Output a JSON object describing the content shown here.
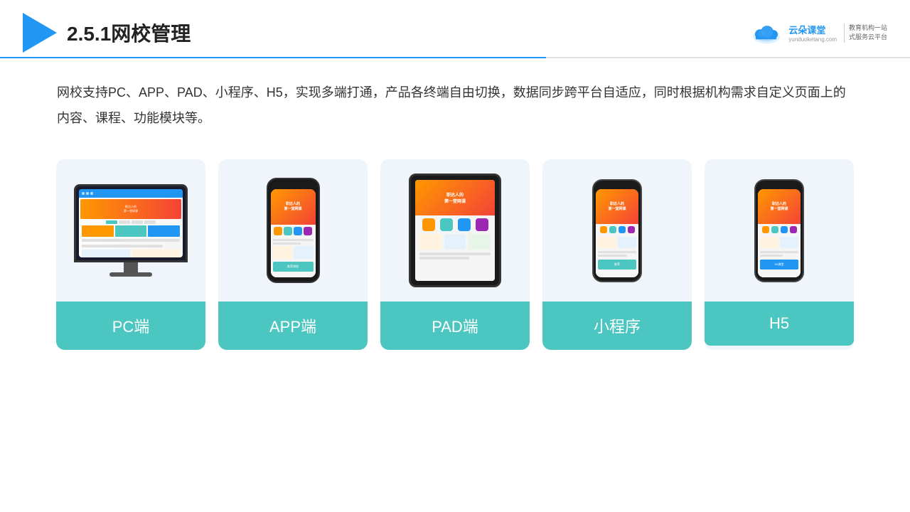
{
  "header": {
    "title": "2.5.1网校管理",
    "brand_cn": "云朵课堂",
    "brand_en": "yunduoketang.com",
    "brand_slogan_line1": "教育机构一站",
    "brand_slogan_line2": "式服务云平台"
  },
  "description": {
    "text": "网校支持PC、APP、PAD、小程序、H5，实现多端打通，产品各终端自由切换，数据同步跨平台自适应，同时根据机构需求自定义页面上的内容、课程、功能模块等。"
  },
  "cards": [
    {
      "id": "pc",
      "label": "PC端"
    },
    {
      "id": "app",
      "label": "APP端"
    },
    {
      "id": "pad",
      "label": "PAD端"
    },
    {
      "id": "miniprogram",
      "label": "小程序"
    },
    {
      "id": "h5",
      "label": "H5"
    }
  ],
  "colors": {
    "accent": "#4CC6C0",
    "blue": "#2196F3",
    "card_bg": "#f0f4fb"
  }
}
